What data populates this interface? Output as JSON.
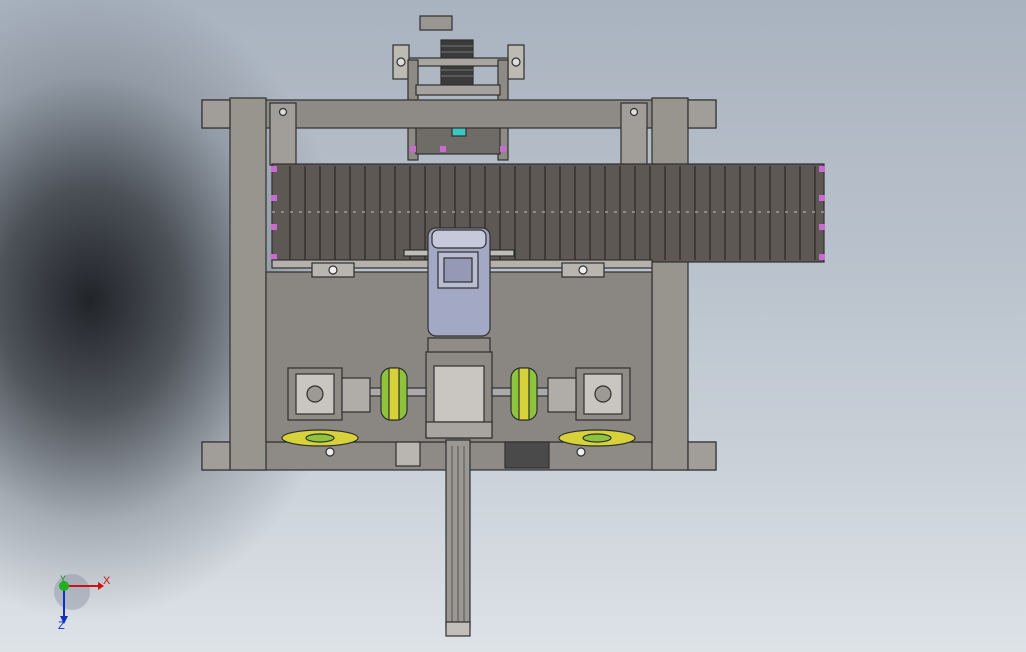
{
  "view": {
    "orientation_triad": {
      "x_label": "X",
      "y_label": "Y",
      "z_label": "Z"
    }
  },
  "colors": {
    "frame": "#8e8b87",
    "frame_dark": "#3a3a3a",
    "chain": "#5e5854",
    "motor": "#a3a8c4",
    "coupling_green": "#8ec43c",
    "coupling_yellow": "#d8d23a",
    "pin_magenta": "#c86ad0",
    "teal_accent": "#3ac8c0"
  }
}
